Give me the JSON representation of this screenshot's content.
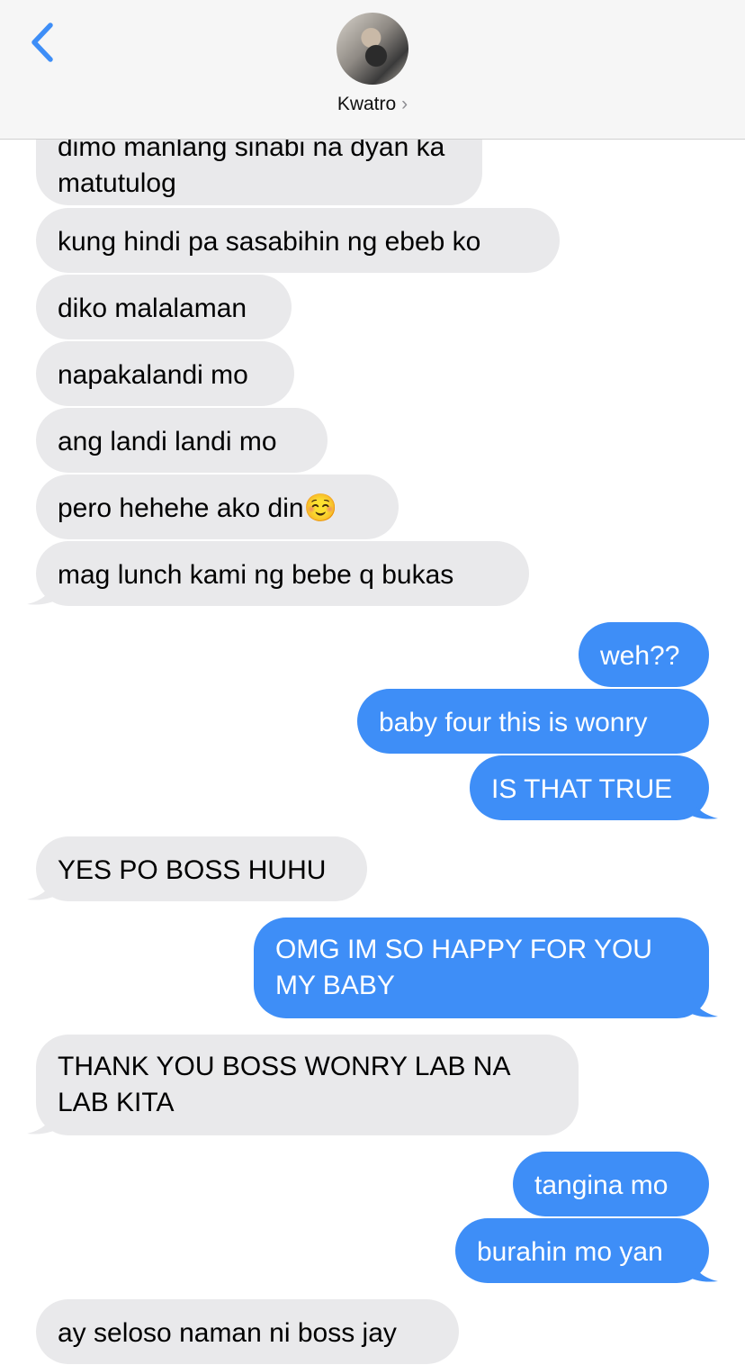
{
  "header": {
    "contact_name": "Kwatro",
    "chevron": "›"
  },
  "messages": [
    {
      "from": "them",
      "text": "dimo manlang sinabi na dyan ka matutulog"
    },
    {
      "from": "them",
      "text": "kung hindi pa sasabihin ng ebeb ko"
    },
    {
      "from": "them",
      "text": "diko malalaman"
    },
    {
      "from": "them",
      "text": "napakalandi mo"
    },
    {
      "from": "them",
      "text": "ang landi landi mo"
    },
    {
      "from": "them",
      "text": "pero hehehe ako din☺️"
    },
    {
      "from": "them",
      "text": "mag lunch kami ng bebe q bukas"
    },
    {
      "from": "me",
      "text": "weh??"
    },
    {
      "from": "me",
      "text": "baby four this is wonry"
    },
    {
      "from": "me",
      "text": "IS THAT TRUE"
    },
    {
      "from": "them",
      "text": "YES PO BOSS HUHU"
    },
    {
      "from": "me",
      "text": "OMG IM SO HAPPY FOR YOU MY BABY"
    },
    {
      "from": "them",
      "text": "THANK YOU BOSS WONRY LAB NA LAB KITA"
    },
    {
      "from": "me",
      "text": "tangina mo"
    },
    {
      "from": "me",
      "text": "burahin mo yan"
    },
    {
      "from": "them",
      "text": "ay seloso naman ni boss jay"
    }
  ],
  "colors": {
    "sent_bubble": "#3e8ef7",
    "received_bubble": "#e9e9eb",
    "header_bg": "#f6f6f6",
    "back_arrow": "#3e8ef7"
  },
  "icons": [
    "back-arrow-icon",
    "avatar",
    "chevron-right-icon"
  ]
}
